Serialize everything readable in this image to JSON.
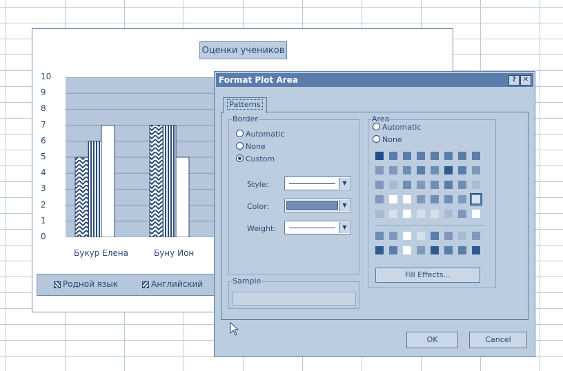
{
  "chart": {
    "title": "Оценки учеников",
    "y_ticks": [
      "10",
      "9",
      "8",
      "7",
      "6",
      "5",
      "4",
      "3",
      "2",
      "1",
      "0"
    ],
    "categories": [
      "Букур Елена",
      "Буну Ион"
    ],
    "legend": [
      "Родной язык",
      "Английский"
    ]
  },
  "chart_data": {
    "type": "bar",
    "title": "Оценки учеников",
    "categories": [
      "Букур Елена",
      "Буну Ион"
    ],
    "series": [
      {
        "name": "Родной язык",
        "values": [
          5,
          7
        ]
      },
      {
        "name": "Английский",
        "values": [
          6,
          7
        ]
      },
      {
        "name": "",
        "values": [
          7,
          5
        ]
      }
    ],
    "ylim": [
      0,
      10
    ]
  },
  "dialog": {
    "title": "Format Plot Area",
    "help_label": "?",
    "close_label": "✕",
    "tab_label": "Patterns",
    "border": {
      "label": "Border",
      "options": [
        "Automatic",
        "None",
        "Custom"
      ],
      "selected": "Custom",
      "style_label": "Style:",
      "color_label": "Color:",
      "weight_label": "Weight:"
    },
    "area": {
      "label": "Area",
      "options": [
        "Automatic",
        "None"
      ],
      "fill_effects_label": "Fill Effects..."
    },
    "sample_label": "Sample",
    "ok_label": "OK",
    "cancel_label": "Cancel"
  },
  "colors": {
    "accent": "#5a7dab",
    "chart_plot": "#b6c7dc",
    "text": "#2a4a75"
  }
}
